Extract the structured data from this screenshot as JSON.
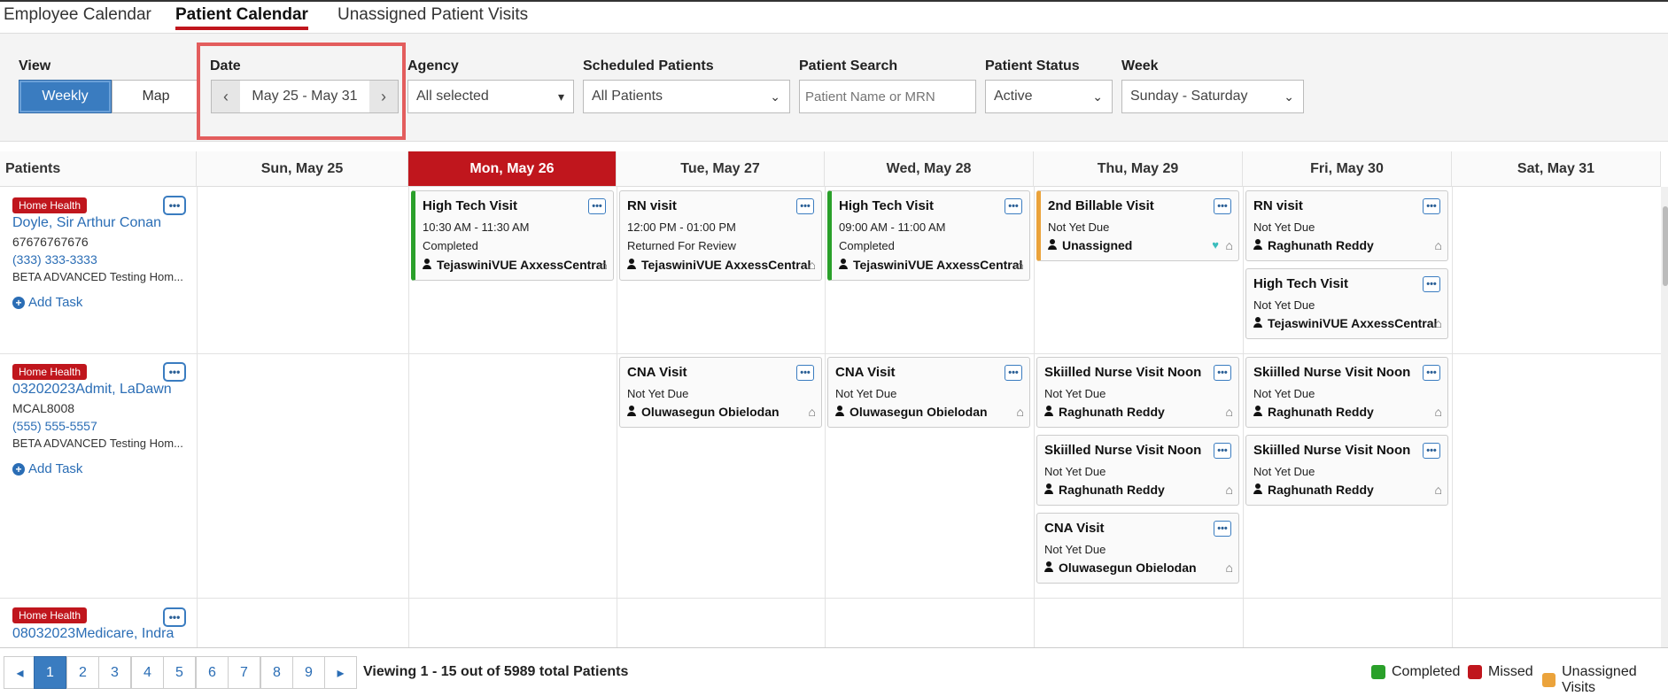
{
  "tabs": [
    "Employee Calendar",
    "Patient Calendar",
    "Unassigned Patient Visits"
  ],
  "filters": {
    "view_label": "View",
    "view_weekly": "Weekly",
    "view_map": "Map",
    "date_label": "Date",
    "date_range": "May 25 - May 31",
    "agency_label": "Agency",
    "agency_value": "All selected",
    "scheduled_label": "Scheduled Patients",
    "scheduled_value": "All Patients",
    "search_label": "Patient Search",
    "search_placeholder": "Patient Name or MRN",
    "status_label": "Patient Status",
    "status_value": "Active",
    "week_label": "Week",
    "week_value": "Sunday - Saturday"
  },
  "columns": [
    "Patients",
    "Sun, May 25",
    "Mon, May 26",
    "Tue, May 27",
    "Wed, May 28",
    "Thu, May 29",
    "Fri, May 30",
    "Sat, May 31"
  ],
  "patients": [
    {
      "badge": "Home Health",
      "name": "Doyle, Sir Arthur Conan",
      "mrn": "67676767676",
      "phone": "(333) 333-3333",
      "agency": "BETA ADVANCED Testing Hom...",
      "add_task": "Add Task"
    },
    {
      "badge": "Home Health",
      "name": "03202023Admit, LaDawn",
      "mrn": "MCAL8008",
      "phone": "(555) 555-5557",
      "agency": "BETA ADVANCED Testing Hom...",
      "add_task": "Add Task"
    },
    {
      "badge": "Home Health",
      "name": "08032023Medicare, Indra"
    }
  ],
  "visits": {
    "r0_mon": {
      "title": "High Tech Visit",
      "time": "10:30 AM - 11:30 AM",
      "status": "Completed",
      "who": "TejaswiniVUE AxxessCentral"
    },
    "r0_tue": {
      "title": "RN visit",
      "time": "12:00 PM - 01:00 PM",
      "status": "Returned For Review",
      "who": "TejaswiniVUE AxxessCentral"
    },
    "r0_wed": {
      "title": "High Tech Visit",
      "time": "09:00 AM - 11:00 AM",
      "status": "Completed",
      "who": "TejaswiniVUE AxxessCentral"
    },
    "r0_thu": {
      "title": "2nd Billable Visit",
      "status": "Not Yet Due",
      "who": "Unassigned"
    },
    "r0_fri1": {
      "title": "RN visit",
      "status": "Not Yet Due",
      "who": "Raghunath Reddy"
    },
    "r0_fri2": {
      "title": "High Tech Visit",
      "status": "Not Yet Due",
      "who": "TejaswiniVUE AxxessCentral"
    },
    "r1_tue": {
      "title": "CNA Visit",
      "status": "Not Yet Due",
      "who": "Oluwasegun Obielodan"
    },
    "r1_wed": {
      "title": "CNA Visit",
      "status": "Not Yet Due",
      "who": "Oluwasegun Obielodan"
    },
    "r1_thu1": {
      "title": "Skiilled Nurse Visit Noon",
      "status": "Not Yet Due",
      "who": "Raghunath Reddy"
    },
    "r1_thu2": {
      "title": "Skiilled Nurse Visit Noon",
      "status": "Not Yet Due",
      "who": "Raghunath Reddy"
    },
    "r1_thu3": {
      "title": "CNA Visit",
      "status": "Not Yet Due",
      "who": "Oluwasegun Obielodan"
    },
    "r1_fri1": {
      "title": "Skiilled Nurse Visit Noon",
      "status": "Not Yet Due",
      "who": "Raghunath Reddy"
    },
    "r1_fri2": {
      "title": "Skiilled Nurse Visit Noon",
      "status": "Not Yet Due",
      "who": "Raghunath Reddy"
    }
  },
  "pagination": {
    "pages": [
      "1",
      "2",
      "3",
      "4",
      "5",
      "6",
      "7",
      "8",
      "9"
    ],
    "viewing": "Viewing 1 - 15 out of 5989 total Patients"
  },
  "legend": [
    {
      "label": "Completed",
      "color": "#2aa02a"
    },
    {
      "label": "Missed",
      "color": "#c0161d"
    },
    {
      "label": "Unassigned Visits",
      "color": "#eba33b"
    }
  ],
  "colors": {
    "accent": "#3a7cc0",
    "brand_red": "#c0161d",
    "highlight": "#e35d5d"
  }
}
